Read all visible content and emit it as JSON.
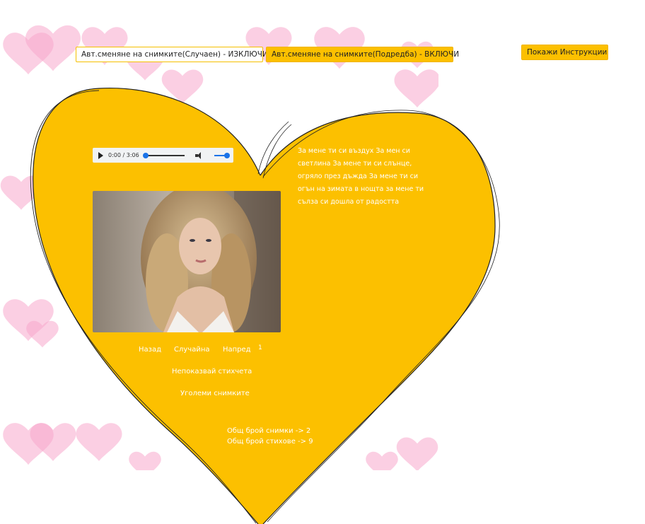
{
  "controls": {
    "random_toggle_label": "Авт.сменяне на снимките(Случаен) - ИЗКЛЮЧИ.",
    "ordered_toggle_label": "Авт.сменяне на снимките(Подредба) - ВКЛЮЧИ",
    "instructions_label": "Покажи Инструкции"
  },
  "audio": {
    "time": "0:00 / 3:06",
    "progress": 0,
    "volume": 1
  },
  "poem": "За мене ти си въздух За мен си светлина За мене ти си слънце, огряло през дъжда За мене ти си огън на зимата в нощта за мене ти сълза си дошла от радостта",
  "nav": {
    "back": "Назад",
    "random": "Случайна",
    "forward": "Напред",
    "index": "1",
    "hide_poems": "Непоказвай стихчета",
    "enlarge": "Уголеми снимките"
  },
  "stats": {
    "photos": "Общ брой снимки -> 2",
    "poems": "Общ брой стихове -> 9"
  },
  "colors": {
    "accent": "#fcc000",
    "heart_pink": "#f7a8cc"
  }
}
